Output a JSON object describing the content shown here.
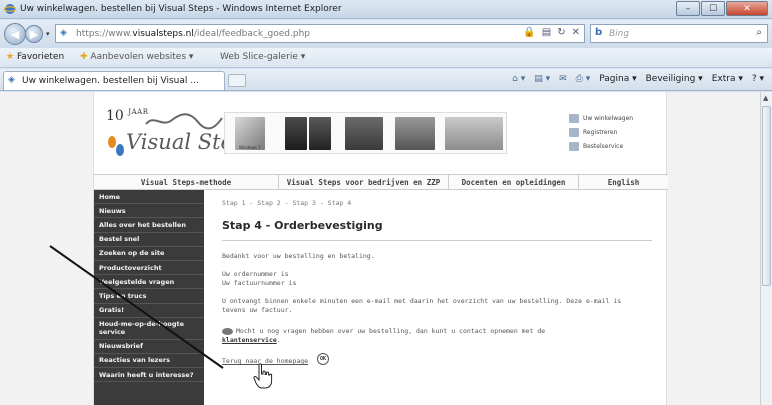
{
  "window": {
    "title": "Uw winkelwagen. bestellen bij Visual Steps - Windows Internet Explorer",
    "min_glyph": "–",
    "max_glyph": "☐",
    "close_glyph": "✕"
  },
  "address": {
    "url_prefix": "https://www.",
    "url_domain": "visualsteps.nl",
    "url_path": "/ideal/feedback_goed.php",
    "search_placeholder": "Bing",
    "search_icon_label": "b"
  },
  "favorites": {
    "favorites_label": "Favorieten",
    "suggested_label": "Aanbevolen websites ▾",
    "slice_label": "Web Slice-galerie ▾"
  },
  "tab": {
    "label": "Uw winkelwagen. bestellen bij Visual ..."
  },
  "commands": {
    "page": "Pagina ▾",
    "safety": "Beveiliging ▾",
    "extra": "Extra ▾",
    "help": "? ▾"
  },
  "site": {
    "logo_ten": "10",
    "logo_jaar": "JAAR",
    "logo_name": "Visual Steps",
    "banner_windows": "Windows 7",
    "top_links": [
      "Uw winkelwagen",
      "Registreren",
      "Bestelservice"
    ],
    "main_nav": [
      "Visual Steps-methode",
      "Visual Steps voor bedrijven en ZZP",
      "Docenten en opleidingen",
      "English"
    ],
    "side_nav": [
      "Home",
      "Nieuws",
      "Alles over het bestellen",
      "Bestel snel",
      "Zoeken op de site",
      "Productoverzicht",
      "Veelgestelde vragen",
      "Tips en trucs",
      "Gratis!",
      "Houd-me-op-de-hoogte service",
      "Nieuwsbrief",
      "Reacties van lezers",
      "Waarin heeft u interesse?"
    ]
  },
  "content": {
    "breadcrumb": "Stap 1 - Stap 2 - Stap 3 - Stap 4",
    "heading": "Stap 4 - Orderbevestiging",
    "thanks": "Bedankt voor uw bestelling en betaling.",
    "order_number": "Uw ordernummer is",
    "invoice_number": "Uw factuurnummer is",
    "email_line1": "U ontvangt binnen enkele minuten een e-mail met daarin het overzicht van uw bestelling. Deze e-mail is",
    "email_line2": "tevens uw factuur.",
    "question_text": "Mocht u nog vragen hebben over uw bestelling, dan kunt u contact opnemen met de",
    "service_link": "klantenservice",
    "back_link": "Terug naar de homepage",
    "ok_label": "OK"
  }
}
